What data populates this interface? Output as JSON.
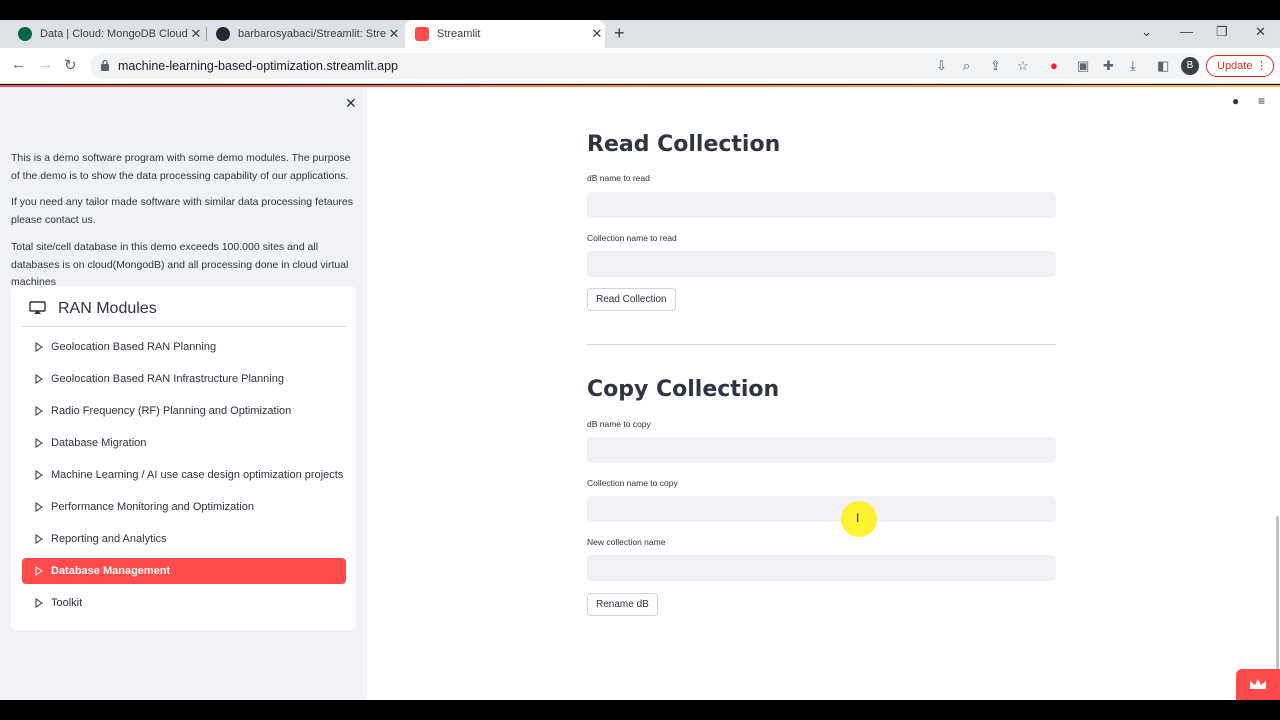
{
  "browser": {
    "tabs": [
      {
        "title": "Data | Cloud: MongoDB Cloud",
        "favicon": "mongodb-leaf-icon",
        "color": "#00684a"
      },
      {
        "title": "barbarosyabaci/Streamlit: Stream",
        "favicon": "github-icon",
        "color": "#24292f"
      },
      {
        "title": "Streamlit",
        "favicon": "streamlit-crown-icon",
        "color": "#ff4b4b"
      }
    ],
    "url": "machine-learning-based-optimization.streamlit.app",
    "update_label": "Update",
    "profile_initial": "B"
  },
  "sidebar": {
    "paragraphs": [
      "This is a demo software program with some demo modules. The purpose of the demo is to show the data processing capability of our applications.",
      "If you need any tailor made software with similar data processing fetaures please contact us.",
      "Total site/cell database in this demo exceeds 100.000 sites and all databases is on cloud(MongodB) and all processing done in cloud virtual machines"
    ],
    "menu": {
      "title": "RAN Modules",
      "items": [
        "Geolocation Based RAN Planning",
        "Geolocation Based RAN Infrastructure Planning",
        "Radio Frequency (RF) Planning and Optimization",
        "Database Migration",
        "Machine Learning / AI use case design optimization projects",
        "Performance Monitoring and Optimization",
        "Reporting and Analytics",
        "Database Management",
        "Toolkit"
      ],
      "selected": "Database Management"
    }
  },
  "main": {
    "read": {
      "heading": "Read Collection",
      "db_label": "dB name to read",
      "collection_label": "Collection name to read",
      "button": "Read Collection"
    },
    "copy": {
      "heading": "Copy Collection",
      "db_label": "dB name to copy",
      "collection_label": "Collection name to copy",
      "new_label": "New collection name",
      "button": "Rename dB"
    }
  },
  "colors": {
    "accent": "#ff4b4b",
    "sidebar_bg": "#f0f2f6"
  }
}
